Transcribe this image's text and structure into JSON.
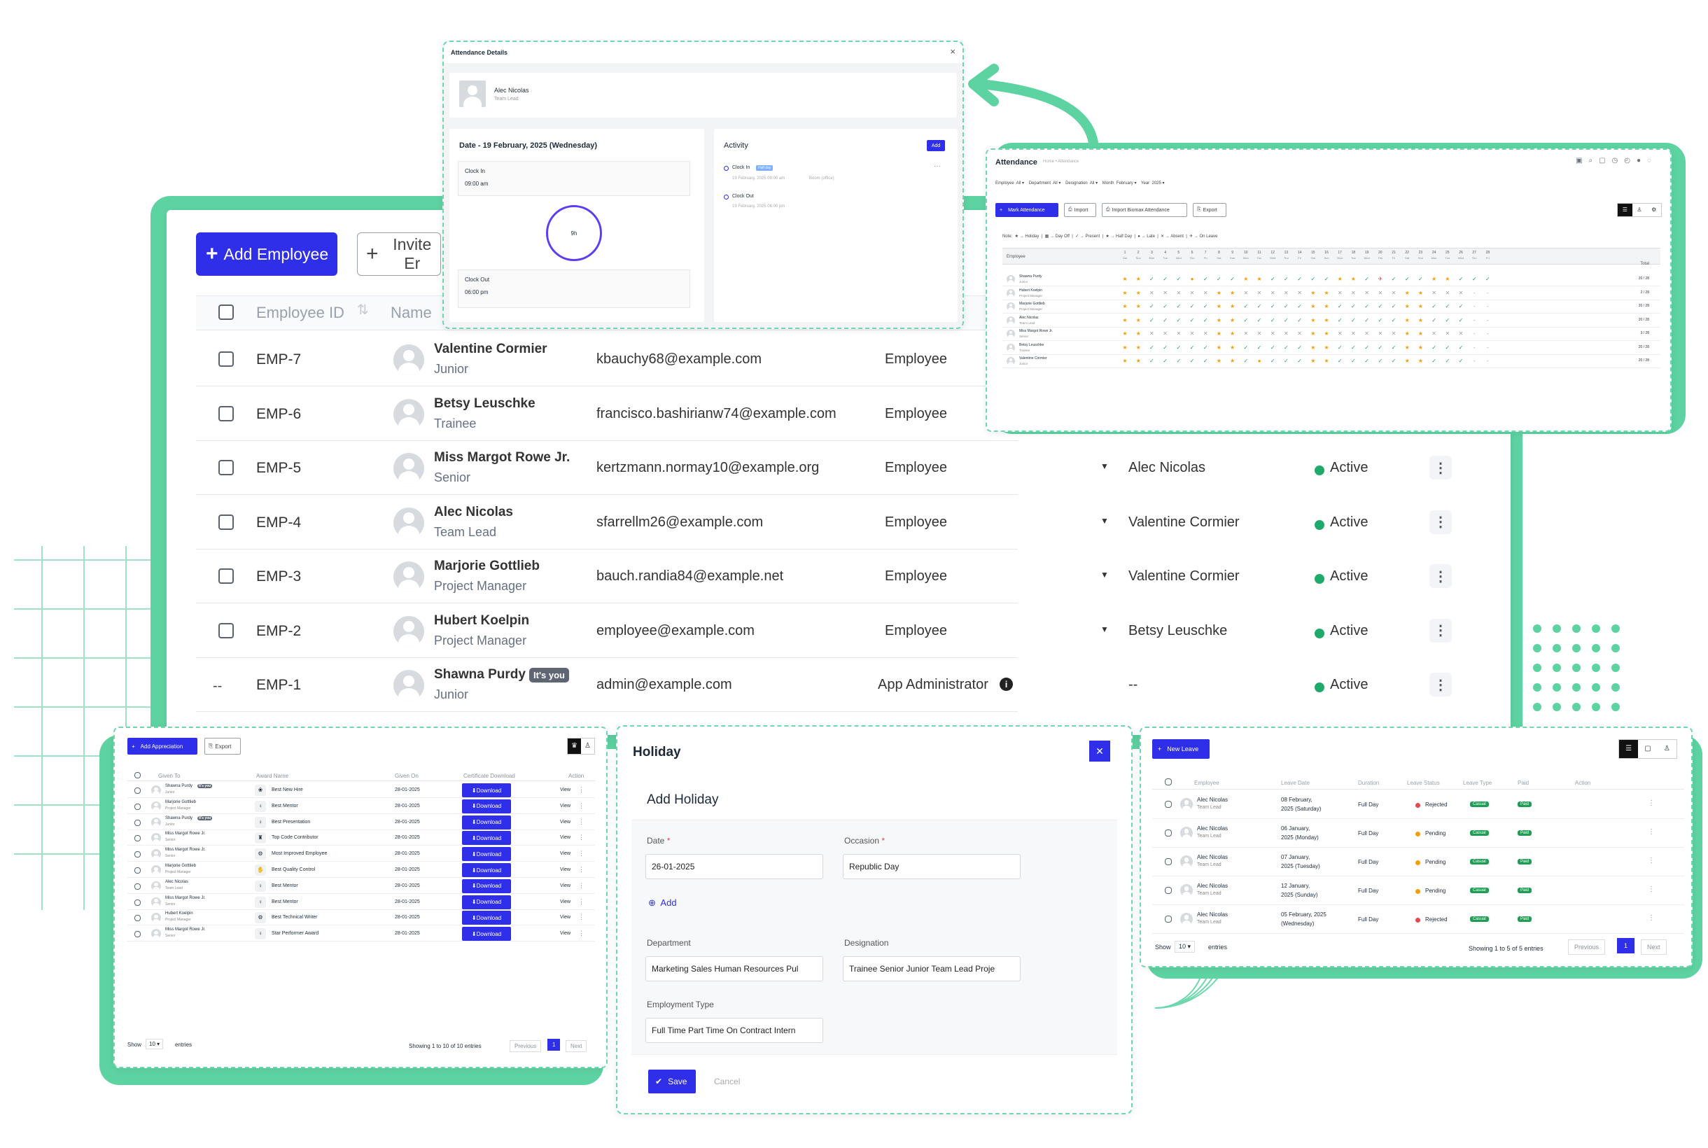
{
  "main": {
    "add_employee_label": "Add Employee",
    "invite_label": "Invite Er",
    "columns": [
      "Employee ID",
      "Name"
    ],
    "rows": [
      {
        "id": "EMP-7",
        "name": "Valentine Cormier",
        "designation": "Junior",
        "email": "kbauchy68@example.com",
        "role": "Employee",
        "reporting": "",
        "status": ""
      },
      {
        "id": "EMP-6",
        "name": "Betsy Leuschke",
        "designation": "Trainee",
        "email": "francisco.bashirianw74@example.com",
        "role": "Employee",
        "reporting": "",
        "status": ""
      },
      {
        "id": "EMP-5",
        "name": "Miss Margot Rowe Jr.",
        "designation": "Senior",
        "email": "kertzmann.normay10@example.org",
        "role": "Employee",
        "reporting": "Alec Nicolas",
        "status": "Active"
      },
      {
        "id": "EMP-4",
        "name": "Alec Nicolas",
        "designation": "Team Lead",
        "email": "sfarrellm26@example.com",
        "role": "Employee",
        "reporting": "Valentine Cormier",
        "status": "Active"
      },
      {
        "id": "EMP-3",
        "name": "Marjorie Gottlieb",
        "designation": "Project Manager",
        "email": "bauch.randia84@example.net",
        "role": "Employee",
        "reporting": "Valentine Cormier",
        "status": "Active"
      },
      {
        "id": "EMP-2",
        "name": "Hubert Koelpin",
        "designation": "Project Manager",
        "email": "employee@example.com",
        "role": "Employee",
        "reporting": "Betsy Leuschke",
        "status": "Active"
      },
      {
        "id": "EMP-1",
        "name": "Shawna Purdy",
        "designation": "Junior",
        "email": "admin@example.com",
        "role": "App Administrator",
        "reporting": "--",
        "status": "Active",
        "badge": "It's you",
        "check": "--"
      }
    ]
  },
  "attendance_details": {
    "title": "Attendance Details",
    "employee_name": "Alec Nicolas",
    "employee_role": "Team Lead",
    "date_heading": "Date - 19 February, 2025 (Wednesday)",
    "clock_in_label": "Clock In",
    "clock_in_time": "09:00 am",
    "duration": "9h",
    "clock_out_label": "Clock Out",
    "clock_out_time": "06:00 pm",
    "activity_label": "Activity",
    "add_label": "Add",
    "act_clock_in": "Clock In",
    "act_clock_in_meta": "19 February, 2025 09:00 am",
    "act_location": "Boom (office)",
    "act_clock_out": "Clock Out",
    "act_clock_out_meta": "19 February, 2025 06:00 pm",
    "act_tag": "Half day"
  },
  "attendance": {
    "title": "Attendance",
    "breadcrumb": "Home • Attendance",
    "filters": "Employee  All ▾    Department  All ▾    Designation  All ▾    Month  February ▾    Year  2025 ▾",
    "mark_label": "Mark Attendance",
    "import_label": "Import",
    "biomax_label": "Import Biomax Attendance",
    "export_label": "Export",
    "note": "Note:  ★ → Holiday  |  ▦ → Day Off  |  ✓ → Present  |  ★ → Half Day  |  ● → Late  |  ✕ → Absent  |  ✈ → On Leave",
    "employee_col": "Employee",
    "total_col": "Total",
    "people": [
      {
        "name": "Shawna Purdy",
        "role": "Junior",
        "total": "20 / 28"
      },
      {
        "name": "Hubert Koelpin",
        "role": "Project Manager",
        "total": "2 / 28"
      },
      {
        "name": "Marjorie Gottlieb",
        "role": "Project Manager",
        "total": "20 / 28"
      },
      {
        "name": "Alec Nicolas",
        "role": "Team Lead",
        "total": "20 / 28"
      },
      {
        "name": "Miss Margot Rowe Jr.",
        "role": "Senior",
        "total": "3 / 28"
      },
      {
        "name": "Betsy Leuschke",
        "role": "Trainee",
        "total": "20 / 28"
      },
      {
        "name": "Valentine Cormier",
        "role": "Junior",
        "total": "20 / 28"
      }
    ]
  },
  "appreciation": {
    "add_label": "Add Appreciation",
    "export_label": "Export",
    "columns": [
      "Given To",
      "Award Name",
      "Given On",
      "Certificate Download",
      "Action"
    ],
    "download_label": "Download",
    "view_label": "View",
    "rows": [
      {
        "name": "Shawna Purdy",
        "role": "Junior",
        "you": "It's you",
        "award": "Best New Hire",
        "date": "28-01-2025"
      },
      {
        "name": "Marjorie Gottlieb",
        "role": "Project Manager",
        "award": "Best Mentor",
        "date": "28-01-2025"
      },
      {
        "name": "Shawna Purdy",
        "role": "Junior",
        "you": "It's you",
        "award": "Best Presentation",
        "date": "28-01-2025"
      },
      {
        "name": "Miss Margot Rowe Jr.",
        "role": "Senior",
        "award": "Top Code Contributor",
        "date": "28-01-2025"
      },
      {
        "name": "Miss Margot Rowe Jr.",
        "role": "Senior",
        "award": "Most Improved Employee",
        "date": "28-01-2025"
      },
      {
        "name": "Marjorie Gottlieb",
        "role": "Project Manager",
        "award": "Best Quality Control",
        "date": "28-01-2025"
      },
      {
        "name": "Alec Nicolas",
        "role": "Team Lead",
        "award": "Best Mentor",
        "date": "28-01-2025"
      },
      {
        "name": "Miss Margot Rowe Jr.",
        "role": "Senior",
        "award": "Best Mentor",
        "date": "28-01-2025"
      },
      {
        "name": "Hubert Koelpin",
        "role": "Project Manager",
        "award": "Best Technical Writer",
        "date": "28-01-2025"
      },
      {
        "name": "Miss Margot Rowe Jr.",
        "role": "Senior",
        "award": "Star Performer Award",
        "date": "28-01-2025"
      }
    ],
    "show_label": "Show",
    "show_value": "10 ▾",
    "entries_label": "entries",
    "summary": "Showing 1 to 10 of 10 entries",
    "prev": "Previous",
    "page": "1",
    "next": "Next"
  },
  "holiday": {
    "title": "Holiday",
    "close": "✕",
    "subtitle": "Add Holiday",
    "date_label": "Date",
    "date_value": "26-01-2025",
    "occasion_label": "Occasion",
    "occasion_value": "Republic Day",
    "add_label": "Add",
    "department_label": "Department",
    "department_value": "Marketing Sales Human Resources Pul",
    "designation_label": "Designation",
    "designation_value": "Trainee Senior Junior Team Lead Proje",
    "employment_label": "Employment Type",
    "employment_value": "Full Time Part Time On Contract Intern",
    "save_label": "Save",
    "cancel_label": "Cancel"
  },
  "leave": {
    "new_label": "New Leave",
    "columns": [
      "Employee",
      "Leave Date",
      "Duration",
      "Leave Status",
      "Leave Type",
      "Paid",
      "Action"
    ],
    "rows": [
      {
        "name": "Alec Nicolas",
        "role": "Team Lead",
        "date1": "08 February,",
        "date2": "2025 (Saturday)",
        "duration": "Full Day",
        "status": "Rejected",
        "type": "Casual",
        "paid": "Paid"
      },
      {
        "name": "Alec Nicolas",
        "role": "Team Lead",
        "date1": "06 January,",
        "date2": "2025 (Monday)",
        "duration": "Full Day",
        "status": "Pending",
        "type": "Casual",
        "paid": "Paid"
      },
      {
        "name": "Alec Nicolas",
        "role": "Team Lead",
        "date1": "07 January,",
        "date2": "2025 (Tuesday)",
        "duration": "Full Day",
        "status": "Pending",
        "type": "Casual",
        "paid": "Paid"
      },
      {
        "name": "Alec Nicolas",
        "role": "Team Lead",
        "date1": "12 January,",
        "date2": "2025 (Sunday)",
        "duration": "Full Day",
        "status": "Pending",
        "type": "Casual",
        "paid": "Paid"
      },
      {
        "name": "Alec Nicolas",
        "role": "Team Lead",
        "date1": "05 February, 2025",
        "date2": "(Wednesday)",
        "duration": "Full Day",
        "status": "Rejected",
        "type": "Casual",
        "paid": "Paid"
      }
    ],
    "show_label": "Show",
    "show_value": "10 ▾",
    "entries_label": "entries",
    "summary": "Showing 1 to 5 of 5 entries",
    "prev": "Previous",
    "page": "1",
    "next": "Next"
  },
  "colors": {
    "primary": "#2f2ee8",
    "accent_green": "#5ed3a2",
    "active": "#1faa6b",
    "rejected": "#e5484d",
    "pending": "#f59e0b"
  }
}
